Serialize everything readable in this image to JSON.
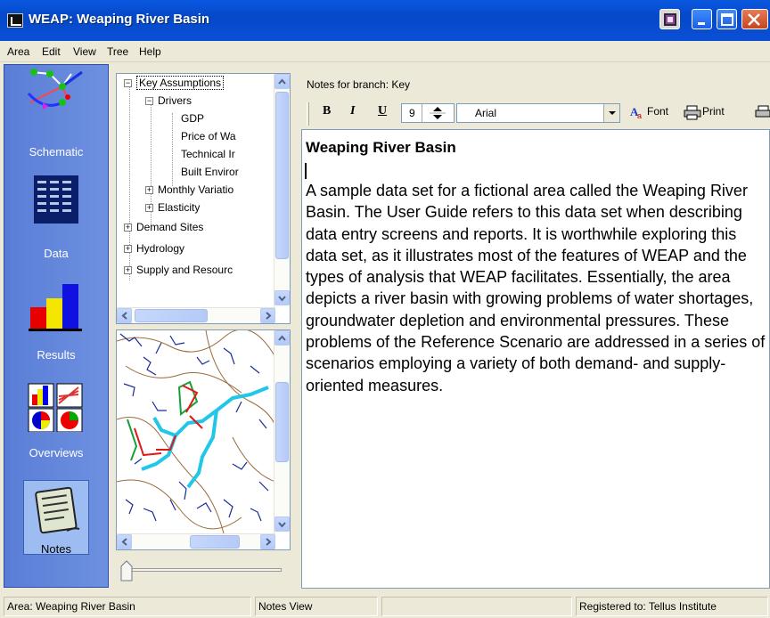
{
  "window": {
    "title": "WEAP: Weaping River Basin"
  },
  "menu": [
    "Area",
    "Edit",
    "View",
    "Tree",
    "Help"
  ],
  "sidebar": {
    "items": [
      {
        "label": "Schematic",
        "icon": "schematic-icon"
      },
      {
        "label": "Data",
        "icon": "data-icon"
      },
      {
        "label": "Results",
        "icon": "results-icon"
      },
      {
        "label": "Overviews",
        "icon": "overviews-icon"
      },
      {
        "label": "Notes",
        "icon": "notes-icon",
        "active": true
      }
    ]
  },
  "tree": {
    "items": [
      {
        "label": "Key Assumptions",
        "expander": "−",
        "selected": true
      },
      {
        "label": "Drivers",
        "expander": "−"
      },
      {
        "label": "GDP"
      },
      {
        "label": "Price of Wa"
      },
      {
        "label": "Technical Ir"
      },
      {
        "label": "Built Enviror"
      },
      {
        "label": "Monthly Variatio",
        "expander": "+"
      },
      {
        "label": "Elasticity",
        "expander": "+"
      },
      {
        "label": "Demand Sites",
        "expander": "+"
      },
      {
        "label": "Hydrology",
        "expander": "+"
      },
      {
        "label": "Supply and Resourc",
        "expander": "+"
      }
    ]
  },
  "notes": {
    "header": "Notes for branch: Key",
    "toolbar": {
      "bold": "B",
      "italic": "I",
      "underline": "U",
      "font_size": "9",
      "font_name": "Arial",
      "font_button": "Font",
      "print_button": "Print"
    },
    "title": "Weaping River Basin",
    "body": "A sample data set for a fictional area called the Weaping River Basin. The User Guide refers to this data set when describing data entry screens and reports. It is worthwhile exploring this data set, as it illustrates most of the features of WEAP and the types of analysis that WEAP facilitates. Essentially, the area depicts a river basin with growing problems of water shortages, groundwater depletion and environmental pressures. These problems of the Reference Scenario are addressed in a series of scenarios employing a variety of both demand- and supply-oriented measures."
  },
  "status": {
    "area": "Area: Weaping River Basin",
    "view": "Notes View",
    "registered": "Registered to: Tellus Institute"
  },
  "colors": {
    "titlebar": "#0a58e0",
    "sidebar": "#6d90e0",
    "river": "#22c6e6"
  }
}
